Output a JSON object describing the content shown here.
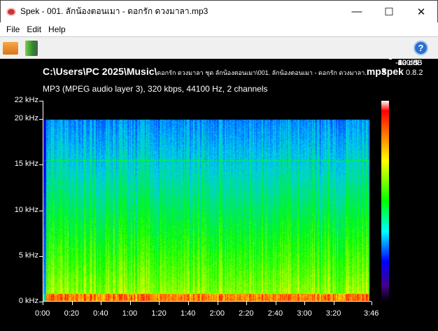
{
  "window": {
    "title": "Spek - 001. ลักน้องตอนเมา - ดอกรัก ดวงมาลา.mp3",
    "minimize": "—",
    "maximize": "☐",
    "close": "✕"
  },
  "menu": [
    "File",
    "Edit",
    "Help"
  ],
  "toolbar": {
    "open_icon": "folder-icon",
    "save_icon": "save-icon",
    "help": "?"
  },
  "header": {
    "path_prefix": "C:\\Users\\PC 2025\\Music\\",
    "path_rest": "ดอกรัก ดวงมาลา ชุด ลักน้องตอนเมา\\001. ลักน้องตอนเมา - ดอกรัก ดวงมาลา.",
    "ext": "mp3",
    "app": "spek",
    "version": "0.8.2",
    "info": "MP3 (MPEG audio layer 3), 320 kbps, 44100 Hz, 2 channels"
  },
  "freq_ticks": [
    {
      "label": "22 kHz",
      "khz": 22
    },
    {
      "label": "20 kHz",
      "khz": 20
    },
    {
      "label": "15 kHz",
      "khz": 15
    },
    {
      "label": "10 kHz",
      "khz": 10
    },
    {
      "label": "5 kHz",
      "khz": 5
    },
    {
      "label": "0 kHz",
      "khz": 0
    }
  ],
  "time_ticks": [
    {
      "label": "0:00",
      "s": 0
    },
    {
      "label": "0:20",
      "s": 20
    },
    {
      "label": "0:40",
      "s": 40
    },
    {
      "label": "1:00",
      "s": 60
    },
    {
      "label": "1:20",
      "s": 80
    },
    {
      "label": "1:40",
      "s": 100
    },
    {
      "label": "2:00",
      "s": 120
    },
    {
      "label": "2:20",
      "s": 140
    },
    {
      "label": "2:40",
      "s": 160
    },
    {
      "label": "3:00",
      "s": 180
    },
    {
      "label": "3:20",
      "s": 200
    },
    {
      "label": "3:46",
      "s": 226
    }
  ],
  "db_ticks": [
    {
      "label": "-20 dB",
      "db": -20
    },
    {
      "label": "-40 dB",
      "db": -40
    },
    {
      "label": "-60 dB",
      "db": -60
    },
    {
      "label": "-80 dB",
      "db": -80
    },
    {
      "label": "-100 dB",
      "db": -100
    },
    {
      "label": "-120 dB",
      "db": -120
    }
  ],
  "duration_s": 226,
  "max_khz": 22,
  "cutoff_khz": 20
}
